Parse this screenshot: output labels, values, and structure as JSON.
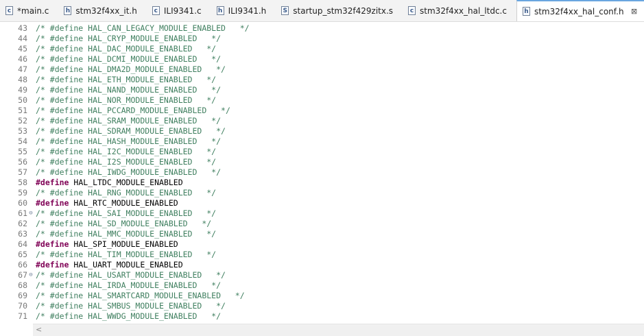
{
  "tabs": [
    {
      "label": "*main.c",
      "icon": "c-file-icon",
      "icon_char": "c",
      "active": false
    },
    {
      "label": "stm32f4xx_it.h",
      "icon": "h-file-icon",
      "icon_char": "h",
      "active": false
    },
    {
      "label": "ILI9341.c",
      "icon": "c-file-icon",
      "icon_char": "c",
      "active": false
    },
    {
      "label": "ILI9341.h",
      "icon": "h-file-icon",
      "icon_char": "h",
      "active": false
    },
    {
      "label": "startup_stm32f429zitx.s",
      "icon": "s-file-icon",
      "icon_char": "S",
      "active": false
    },
    {
      "label": "stm32f4xx_hal_ltdc.c",
      "icon": "c-file-icon",
      "icon_char": "c",
      "active": false
    },
    {
      "label": "stm32f4xx_hal_conf.h",
      "icon": "h-file-icon",
      "icon_char": "h",
      "active": true,
      "close": "⊠"
    }
  ],
  "lines": [
    {
      "n": "43",
      "fold": "",
      "text": "/* #define HAL_CAN_LEGACY_MODULE_ENABLED   */",
      "define": false
    },
    {
      "n": "44",
      "fold": "",
      "text": "/* #define HAL_CRYP_MODULE_ENABLED   */",
      "define": false
    },
    {
      "n": "45",
      "fold": "",
      "text": "/* #define HAL_DAC_MODULE_ENABLED   */",
      "define": false
    },
    {
      "n": "46",
      "fold": "",
      "text": "/* #define HAL_DCMI_MODULE_ENABLED   */",
      "define": false
    },
    {
      "n": "47",
      "fold": "",
      "text": "/* #define HAL_DMA2D_MODULE_ENABLED   */",
      "define": false
    },
    {
      "n": "48",
      "fold": "",
      "text": "/* #define HAL_ETH_MODULE_ENABLED   */",
      "define": false
    },
    {
      "n": "49",
      "fold": "",
      "text": "/* #define HAL_NAND_MODULE_ENABLED   */",
      "define": false
    },
    {
      "n": "50",
      "fold": "",
      "text": "/* #define HAL_NOR_MODULE_ENABLED   */",
      "define": false
    },
    {
      "n": "51",
      "fold": "",
      "text": "/* #define HAL_PCCARD_MODULE_ENABLED   */",
      "define": false
    },
    {
      "n": "52",
      "fold": "",
      "text": "/* #define HAL_SRAM_MODULE_ENABLED   */",
      "define": false
    },
    {
      "n": "53",
      "fold": "",
      "text": "/* #define HAL_SDRAM_MODULE_ENABLED   */",
      "define": false
    },
    {
      "n": "54",
      "fold": "",
      "text": "/* #define HAL_HASH_MODULE_ENABLED   */",
      "define": false
    },
    {
      "n": "55",
      "fold": "",
      "text": "/* #define HAL_I2C_MODULE_ENABLED   */",
      "define": false
    },
    {
      "n": "56",
      "fold": "",
      "text": "/* #define HAL_I2S_MODULE_ENABLED   */",
      "define": false
    },
    {
      "n": "57",
      "fold": "",
      "text": "/* #define HAL_IWDG_MODULE_ENABLED   */",
      "define": false
    },
    {
      "n": "58",
      "fold": "",
      "kw": "#define",
      "rest": " HAL_LTDC_MODULE_ENABLED",
      "define": true
    },
    {
      "n": "59",
      "fold": "",
      "text": "/* #define HAL_RNG_MODULE_ENABLED   */",
      "define": false
    },
    {
      "n": "60",
      "fold": "",
      "kw": "#define",
      "rest": " HAL_RTC_MODULE_ENABLED",
      "define": true
    },
    {
      "n": "61",
      "fold": "⊖",
      "text": "/* #define HAL_SAI_MODULE_ENABLED   */",
      "define": false
    },
    {
      "n": "62",
      "fold": "",
      "text": "/* #define HAL_SD_MODULE_ENABLED   */",
      "define": false
    },
    {
      "n": "63",
      "fold": "",
      "text": "/* #define HAL_MMC_MODULE_ENABLED   */",
      "define": false
    },
    {
      "n": "64",
      "fold": "",
      "kw": "#define",
      "rest": " HAL_SPI_MODULE_ENABLED",
      "define": true
    },
    {
      "n": "65",
      "fold": "",
      "text": "/* #define HAL_TIM_MODULE_ENABLED   */",
      "define": false
    },
    {
      "n": "66",
      "fold": "",
      "kw": "#define",
      "rest": " HAL_UART_MODULE_ENABLED",
      "define": true
    },
    {
      "n": "67",
      "fold": "⊖",
      "text": "/* #define HAL_USART_MODULE_ENABLED   */",
      "define": false
    },
    {
      "n": "68",
      "fold": "",
      "text": "/* #define HAL_IRDA_MODULE_ENABLED   */",
      "define": false
    },
    {
      "n": "69",
      "fold": "",
      "text": "/* #define HAL_SMARTCARD_MODULE_ENABLED   */",
      "define": false
    },
    {
      "n": "70",
      "fold": "",
      "text": "/* #define HAL_SMBUS_MODULE_ENABLED   */",
      "define": false
    },
    {
      "n": "71",
      "fold": "",
      "text": "/* #define HAL_WWDG_MODULE_ENABLED   */",
      "define": false
    }
  ],
  "scrollbar": {
    "left_arrow": "<"
  },
  "colors": {
    "comment": "#3f7f5f",
    "keyword": "#7f0055",
    "line_number": "#787878"
  }
}
